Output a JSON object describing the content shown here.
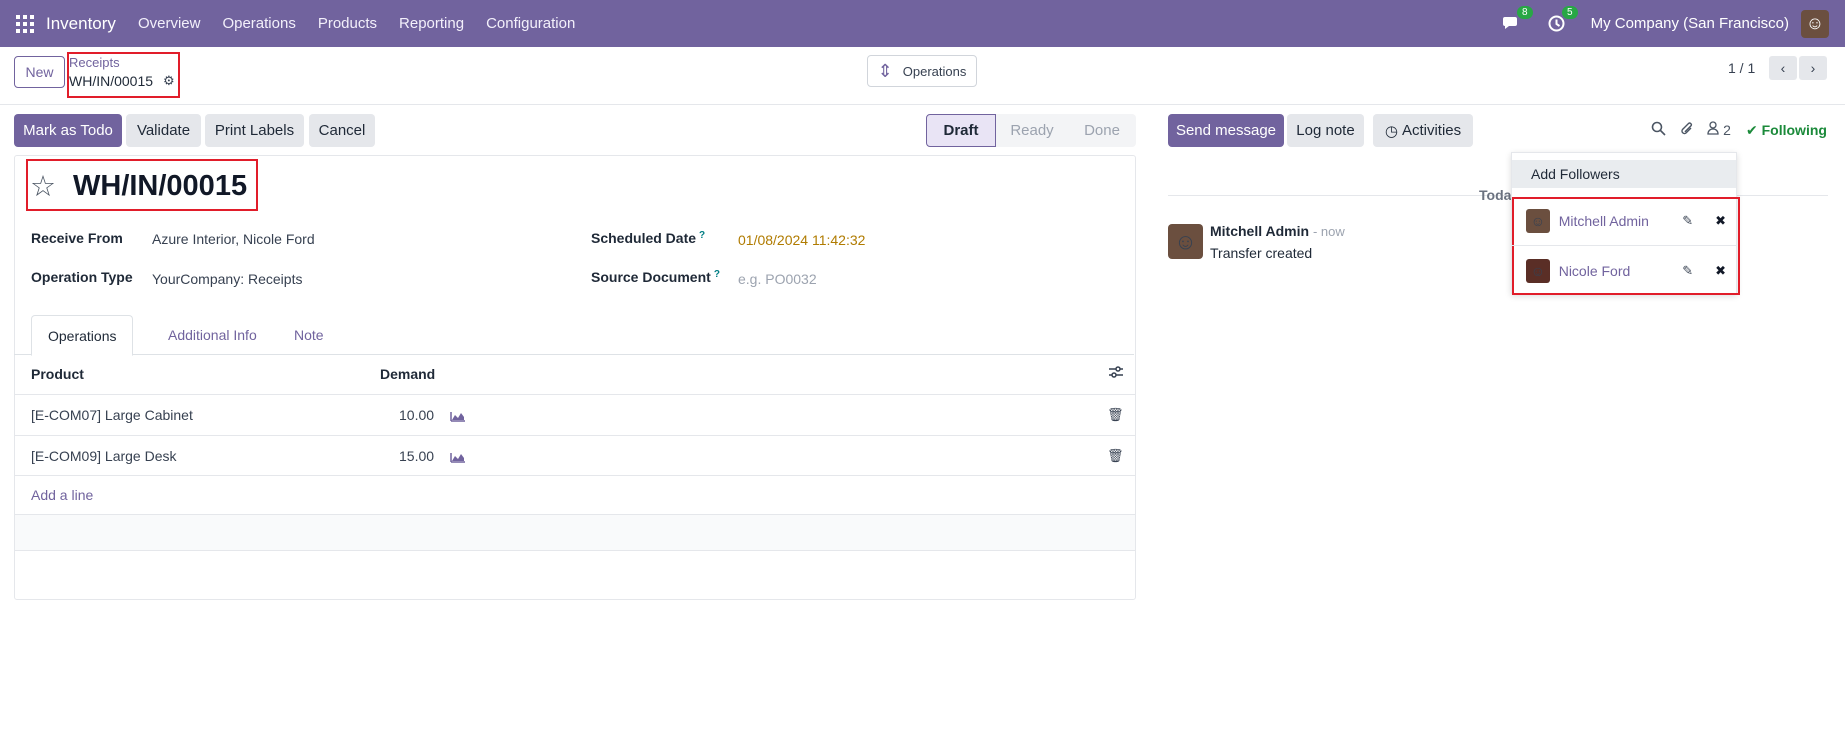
{
  "topbar": {
    "app_name": "Inventory",
    "menu": [
      "Overview",
      "Operations",
      "Products",
      "Reporting",
      "Configuration"
    ],
    "messages_badge": "8",
    "activities_badge": "5",
    "company": "My Company (San Francisco)"
  },
  "control_panel": {
    "new_label": "New",
    "breadcrumb_parent": "Receipts",
    "breadcrumb_current": "WH/IN/00015",
    "operations_label": "Operations",
    "pager": "1 / 1"
  },
  "actions": {
    "mark_todo": "Mark as Todo",
    "validate": "Validate",
    "print_labels": "Print Labels",
    "cancel": "Cancel"
  },
  "status": [
    "Draft",
    "Ready",
    "Done"
  ],
  "record": {
    "title": "WH/IN/00015",
    "receive_from_label": "Receive From",
    "receive_from": "Azure Interior, Nicole Ford",
    "operation_type_label": "Operation Type",
    "operation_type": "YourCompany: Receipts",
    "scheduled_date_label": "Scheduled Date",
    "scheduled_date": "01/08/2024 11:42:32",
    "source_document_label": "Source Document",
    "source_document_placeholder": "e.g. PO0032"
  },
  "tabs": [
    "Operations",
    "Additional Info",
    "Note"
  ],
  "table": {
    "headers": [
      "Product",
      "Demand"
    ],
    "rows": [
      {
        "product": "[E-COM07] Large Cabinet",
        "demand": "10.00"
      },
      {
        "product": "[E-COM09] Large Desk",
        "demand": "15.00"
      }
    ],
    "add_line": "Add a line"
  },
  "chatter": {
    "send_message": "Send message",
    "log_note": "Log note",
    "activities": "Activities",
    "followers_count": "2",
    "following": "Following",
    "today": "Today",
    "message": {
      "author": "Mitchell Admin",
      "time": "- now",
      "body": "Transfer created"
    }
  },
  "followers_dropdown": {
    "add_followers": "Add Followers",
    "followers": [
      "Mitchell Admin",
      "Nicole Ford"
    ]
  },
  "colors": {
    "brand": "#71639e",
    "annotation": "#e11d2a",
    "following": "#1b8a3a"
  }
}
